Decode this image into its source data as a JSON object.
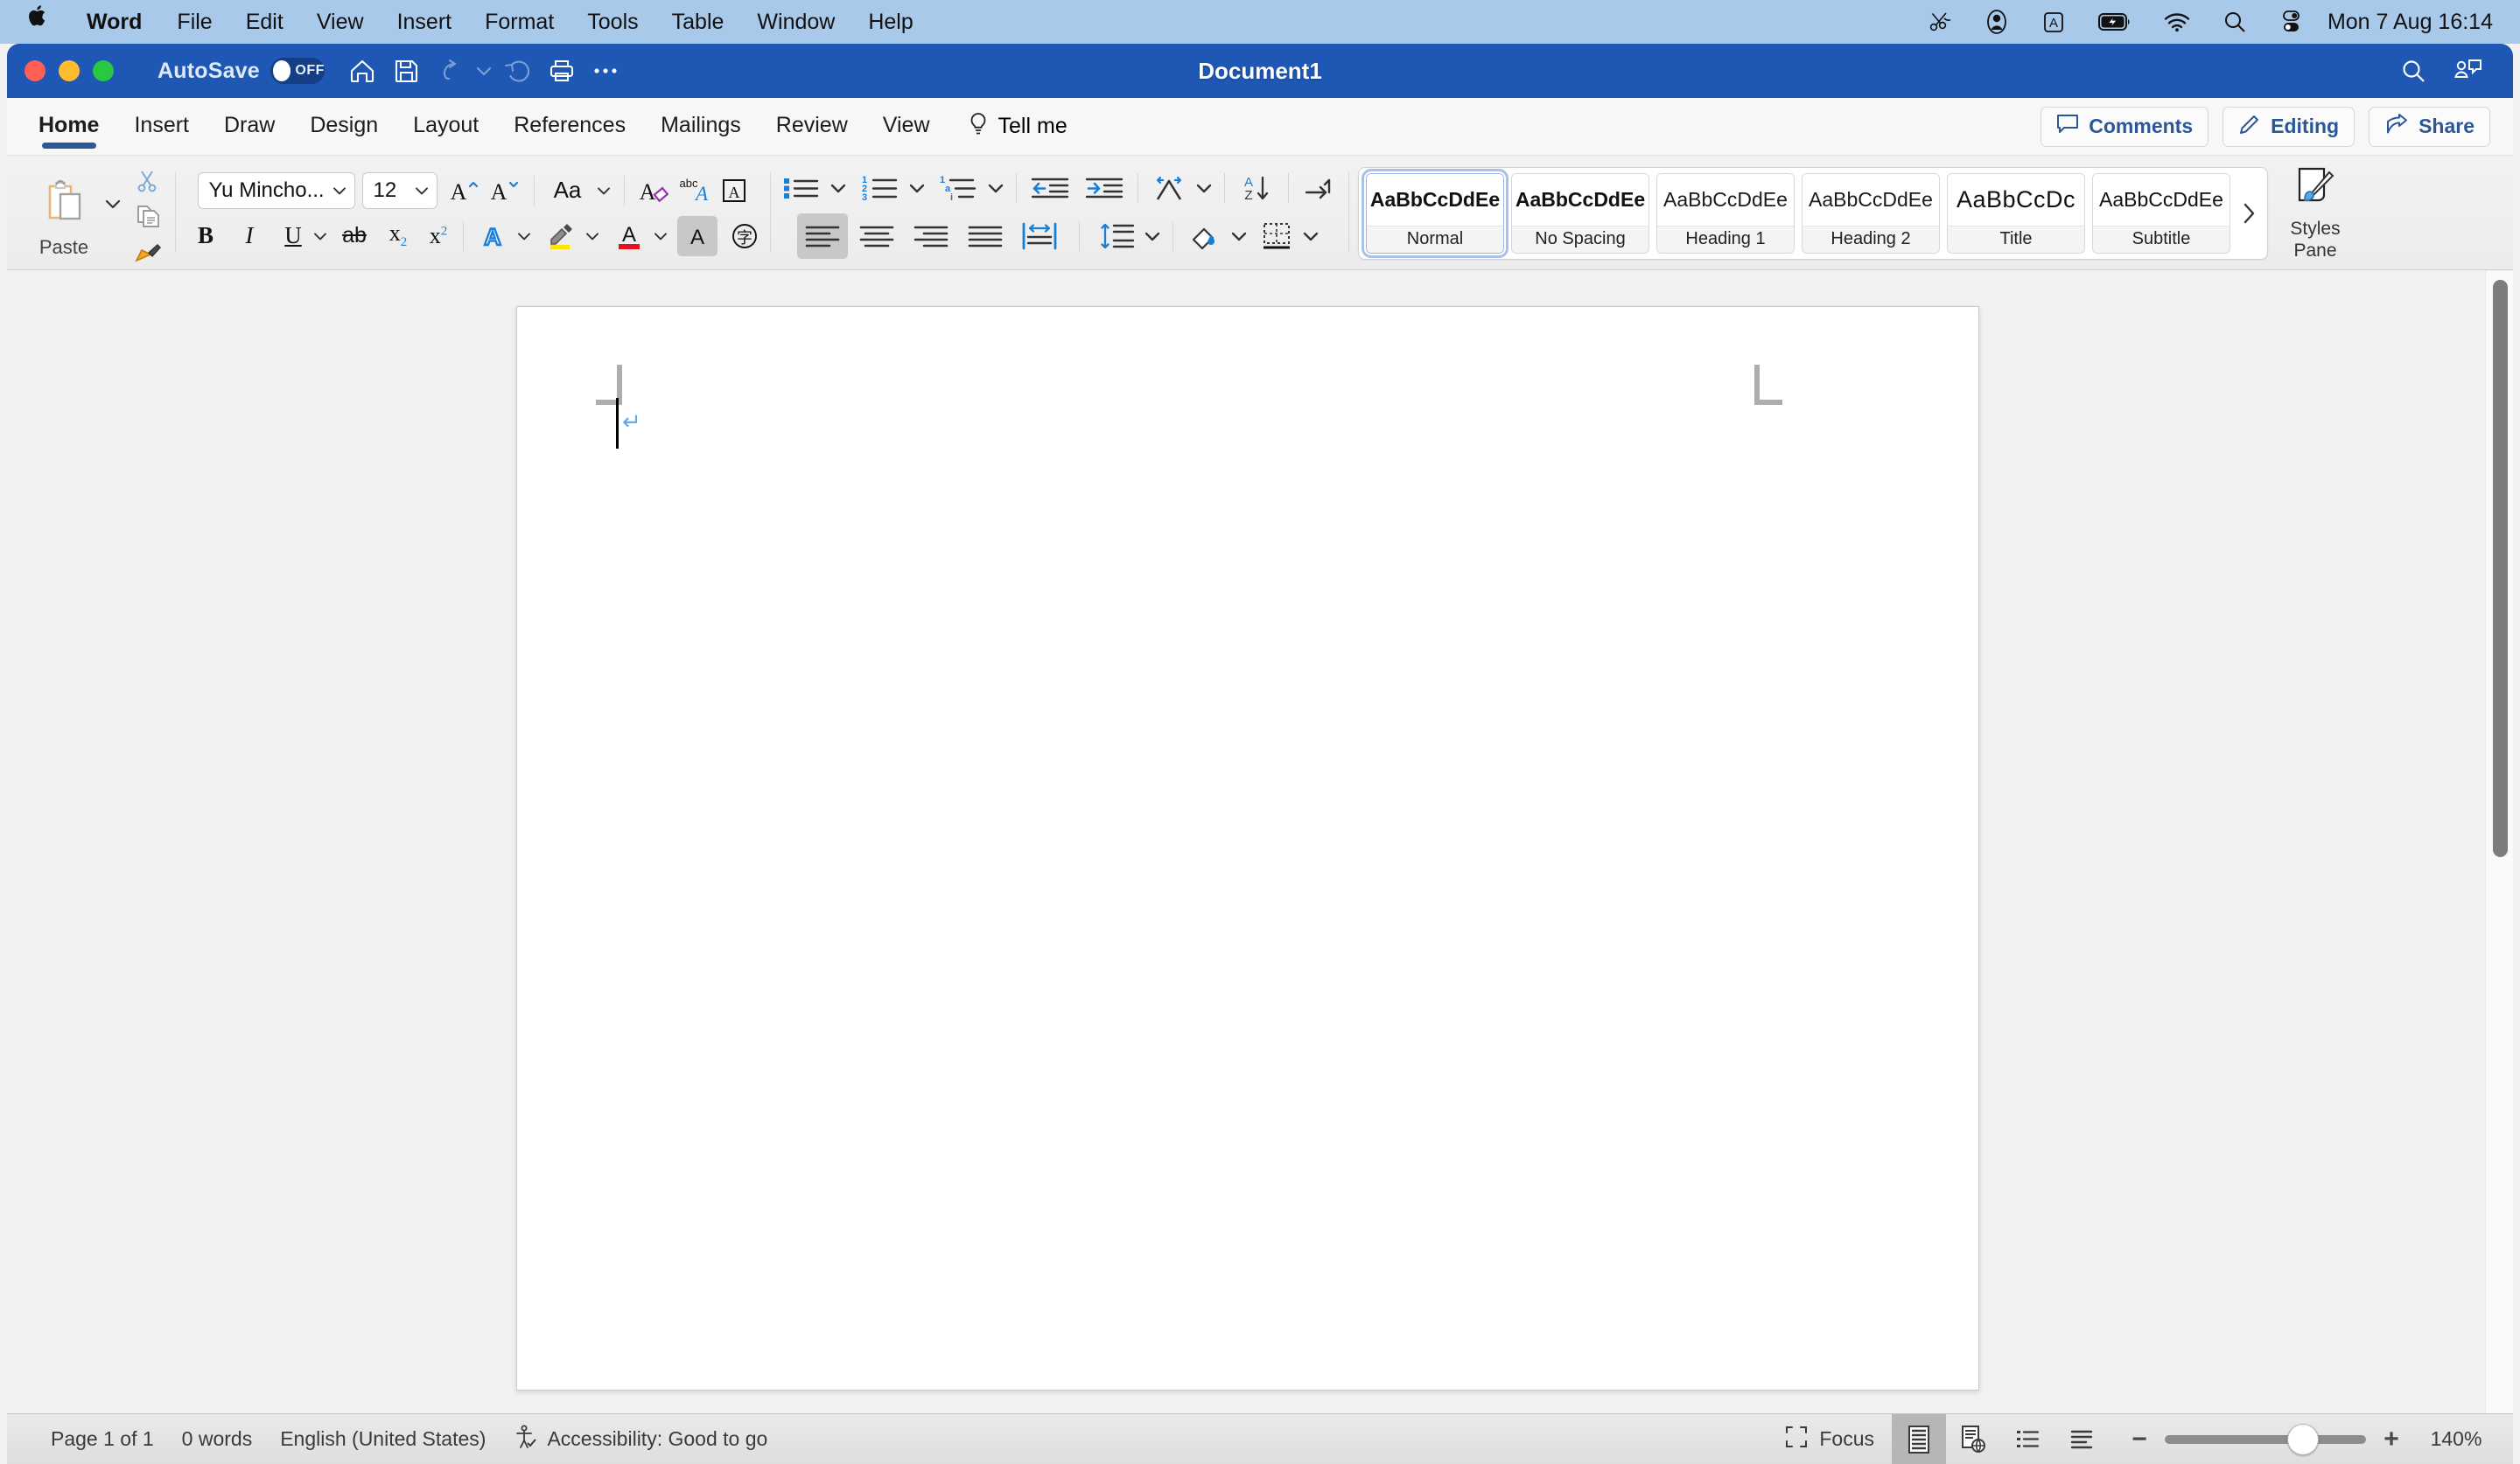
{
  "menubar": {
    "apple_icon": "apple-icon",
    "items": [
      "Word",
      "File",
      "Edit",
      "View",
      "Insert",
      "Format",
      "Tools",
      "Table",
      "Window",
      "Help"
    ],
    "status_icons": [
      "scissors-shortcut-icon",
      "user-account-icon",
      "input-source-A-icon",
      "battery-charging-icon",
      "wifi-icon",
      "spotlight-search-icon",
      "control-center-icon"
    ],
    "clock": "Mon 7 Aug  16:14"
  },
  "titlebar": {
    "autosave_label": "AutoSave",
    "autosave_state": "OFF",
    "document_title": "Document1",
    "quick_access": [
      "home-icon",
      "save-icon",
      "undo-icon",
      "undo-dropdown-icon",
      "redo-icon",
      "print-icon",
      "more-options-icon"
    ],
    "right_icons": [
      "search-icon",
      "collaborators-icon"
    ]
  },
  "ribbon_tabs": {
    "items": [
      "Home",
      "Insert",
      "Draw",
      "Design",
      "Layout",
      "References",
      "Mailings",
      "Review",
      "View"
    ],
    "active": "Home",
    "tell_me": "Tell me",
    "tell_me_icon": "lightbulb-icon",
    "comments_label": "Comments",
    "editing_label": "Editing",
    "share_label": "Share"
  },
  "ribbon": {
    "clipboard": {
      "paste_label": "Paste",
      "paste_icon": "paste-clipboard-icon",
      "paste_dropdown_icon": "chevron-down-icon",
      "cut_icon": "scissors-cut-icon",
      "copy_icon": "copy-pages-icon",
      "format_painter_icon": "format-painter-brush-icon"
    },
    "font": {
      "font_name": "Yu Mincho...",
      "font_size": "12",
      "grow_font_icon": "grow-font-icon",
      "shrink_font_icon": "shrink-font-icon",
      "change_case_icon": "change-case-Aa-icon",
      "clear_formatting_icon": "clear-formatting-icon",
      "spelling_icon": "abc-spelling-icon",
      "character_border_icon": "character-border-icon",
      "bold_label": "B",
      "italic_label": "I",
      "underline_label": "U",
      "strikethrough_label": "ab",
      "subscript_label": "x",
      "subscript_sub": "2",
      "superscript_label": "x",
      "superscript_sup": "2",
      "text_effects_icon": "text-effects-A-icon",
      "highlight_icon": "highlight-marker-icon",
      "font_color_icon": "font-color-A-icon",
      "character_shading_icon": "character-shading-icon",
      "phonetic_guide_icon": "phonetic-guide-icon"
    },
    "paragraph": {
      "bullets_icon": "bullet-list-icon",
      "numbering_icon": "numbered-list-icon",
      "multilevel_icon": "multilevel-list-icon",
      "decrease_indent_icon": "decrease-indent-icon",
      "increase_indent_icon": "increase-indent-icon",
      "align_left_icon": "align-left-icon",
      "align_center_icon": "align-center-icon",
      "align_right_icon": "align-right-icon",
      "justify_icon": "justify-icon",
      "distribute_icon": "distribute-text-icon",
      "line_spacing_icon": "line-spacing-icon",
      "phonetic_asian_icon": "asian-layout-icon",
      "sort_icon": "sort-az-icon",
      "show_marks_icon": "show-paragraph-marks-icon",
      "shading_icon": "shading-fill-icon",
      "borders_icon": "borders-icon"
    },
    "styles": {
      "tiles": [
        {
          "preview": "AaBbCcDdEe",
          "name": "Normal",
          "active": true
        },
        {
          "preview": "AaBbCcDdEe",
          "name": "No Spacing",
          "active": false
        },
        {
          "preview": "AaBbCcDdEe",
          "name": "Heading 1",
          "active": false
        },
        {
          "preview": "AaBbCcDdEe",
          "name": "Heading 2",
          "active": false
        },
        {
          "preview": "AaBbCcDc",
          "name": "Title",
          "active": false
        },
        {
          "preview": "AaBbCcDdEe",
          "name": "Subtitle",
          "active": false
        }
      ],
      "more_icon": "gallery-more-chevron-icon",
      "styles_pane_line1": "Styles",
      "styles_pane_line2": "Pane",
      "styles_pane_icon": "styles-pane-brush-icon"
    }
  },
  "document": {
    "page_margin_mark_icon": "margin-corner-mark",
    "paragraph_mark": "↵",
    "caret": "text-cursor"
  },
  "statusbar": {
    "page_info": "Page 1 of 1",
    "word_count": "0 words",
    "language": "English (United States)",
    "accessibility_icon": "accessibility-person-icon",
    "accessibility": "Accessibility: Good to go",
    "focus_label": "Focus",
    "focus_icon": "focus-frame-icon",
    "view_print_icon": "print-layout-view-icon",
    "view_web_icon": "web-layout-view-icon",
    "view_outline_icon": "outline-view-icon",
    "view_draft_icon": "draft-view-icon",
    "zoom_out_icon": "minus-icon",
    "zoom_in_icon": "plus-icon",
    "zoom_level": "140%"
  },
  "colors": {
    "accent_blue": "#1f57b5",
    "menubar_blue": "#a8c9ea",
    "ribbon_bg": "#f0f0f0",
    "tab_underline": "#2b579a"
  }
}
